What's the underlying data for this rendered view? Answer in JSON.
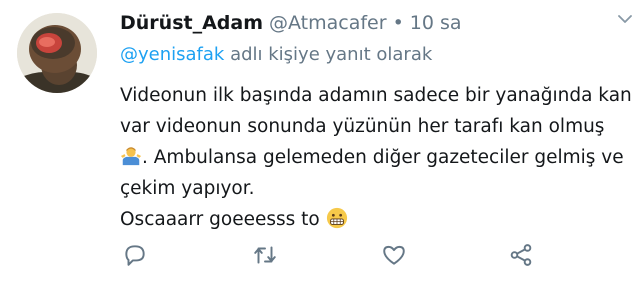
{
  "tweet": {
    "display_name": "Dürüst_Adam",
    "handle": "@Atmacafer",
    "separator": "•",
    "time": "10 sa",
    "reply_to_handle": "@yenisafak",
    "reply_suffix": " adlı kişiye yanıt olarak",
    "body": {
      "line1": "Videonun ilk başında adamın sadece bir yanağında kan",
      "line2": "var videonun sonunda yüzünün her tarafı kan olmuş",
      "line3_text": ". Ambulansa gelemeden diğer gazeteciler gelmiş ve",
      "line4": "çekim yapıyor.",
      "line5_text": "Oscaaarr goeeesss to "
    },
    "emojis": [
      "man-shrugging-emoji",
      "grimacing-face-emoji"
    ]
  },
  "actions": {
    "reply_icon": "reply-icon",
    "retweet_icon": "retweet-icon",
    "like_icon": "heart-icon",
    "share_icon": "share-icon"
  },
  "colors": {
    "link": "#1da1f2",
    "secondary": "#657786",
    "text": "#14171a"
  }
}
